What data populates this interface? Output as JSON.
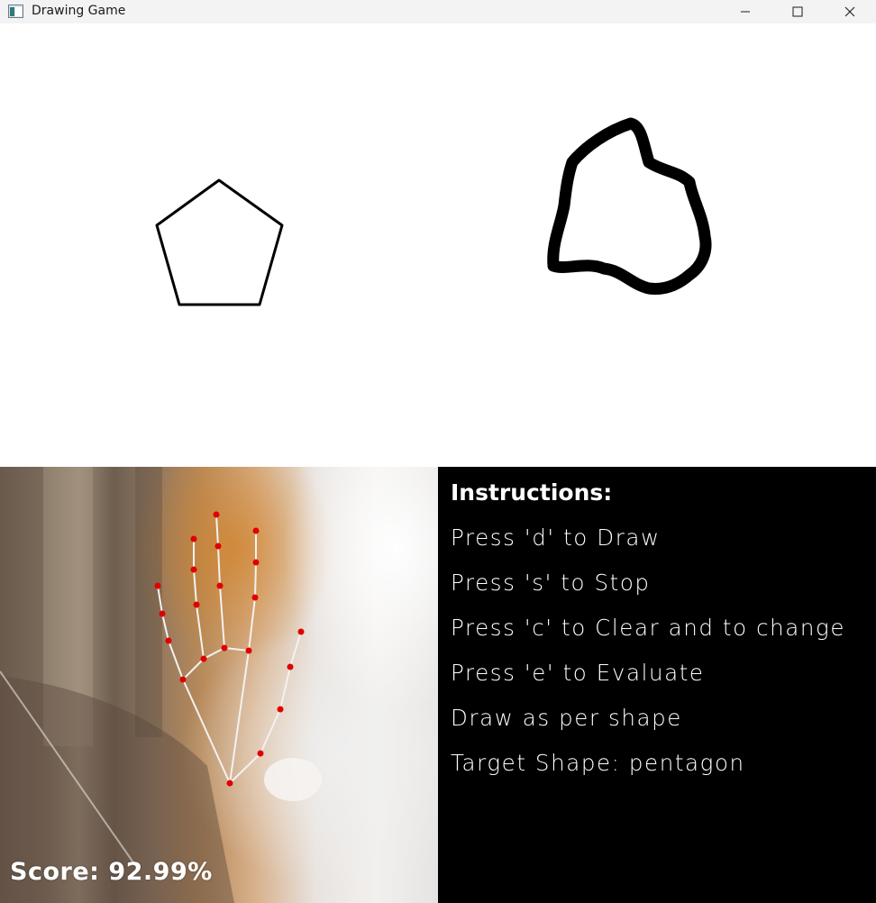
{
  "window": {
    "title": "Drawing Game",
    "controls": {
      "minimize_icon": "minimize-icon",
      "maximize_icon": "maximize-icon",
      "close_icon": "close-icon"
    }
  },
  "canvas": {
    "target_shape_icon": "pentagon-outline",
    "user_drawing_icon": "freehand-stroke"
  },
  "camera": {
    "score_text": "Score: 92.99%",
    "landmark_color": "#e00000",
    "connection_color": "#f2f2f2"
  },
  "instructions": {
    "title": "Instructions:",
    "lines": [
      "Press 'd' to Draw",
      "Press 's' to Stop",
      "Press 'c' to Clear and to change",
      "Press 'e' to Evaluate",
      "Draw as per shape",
      "Target Shape: pentagon"
    ]
  }
}
